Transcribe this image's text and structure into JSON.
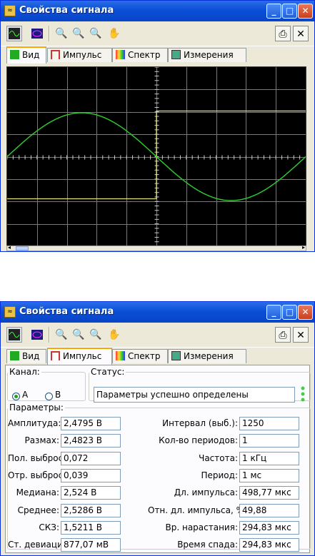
{
  "window": {
    "title": "Свойства сигнала",
    "buttons": {
      "minimize": "_",
      "maximize": "□",
      "close": "✕"
    }
  },
  "toolbar": {
    "tools": [
      "view-signal-icon",
      "scope-icon",
      "zoom-in-icon",
      "zoom-icon",
      "zoom-out-icon",
      "hand-icon"
    ],
    "right_tools": [
      "print-icon",
      "close-panel-icon"
    ]
  },
  "tabs": [
    "Вид",
    "Импульс",
    "Спектр",
    "Измерения"
  ],
  "screen1": {
    "active_tab": "Вид"
  },
  "screen2": {
    "active_tab": "Импульс",
    "channel": {
      "legend": "Канал:",
      "options": [
        "A",
        "B"
      ],
      "selected": "A"
    },
    "status": {
      "legend": "Статус:",
      "text": "Параметры успешно определены"
    },
    "params": {
      "legend": "Параметры:",
      "left": [
        {
          "label": "Амплитуда:",
          "value": "2,4795 В"
        },
        {
          "label": "Размах:",
          "value": "2,4823 В"
        },
        {
          "label": "Пол. выброс, %:",
          "value": "0,072"
        },
        {
          "label": "Отр. выброс, %:",
          "value": "0,039"
        },
        {
          "label": "Медиана:",
          "value": "2,524 В"
        },
        {
          "label": "Среднее:",
          "value": "2,5286 В"
        },
        {
          "label": "СКЗ:",
          "value": "1,5211 В"
        },
        {
          "label": "Ст. девиация:",
          "value": "877,07 мВ"
        }
      ],
      "right": [
        {
          "label": "Интервал (выб.):",
          "value": "1250"
        },
        {
          "label": "Кол-во периодов:",
          "value": "1"
        },
        {
          "label": "Частота:",
          "value": "1 кГц"
        },
        {
          "label": "Период:",
          "value": "1 мс"
        },
        {
          "label": "Дл. импульса:",
          "value": "498,77 мкс"
        },
        {
          "label": "Отн. дл. импульса, %:",
          "value": "49,88"
        },
        {
          "label": "Вр. нарастания:",
          "value": "294,83 мкс"
        },
        {
          "label": "Время спада:",
          "value": "294,83 мкс"
        }
      ]
    }
  },
  "colors": {
    "sine": "#2ed12e",
    "square": "#e8e07a",
    "grid": "#7a7a7a",
    "screen_bg": "#000000"
  }
}
